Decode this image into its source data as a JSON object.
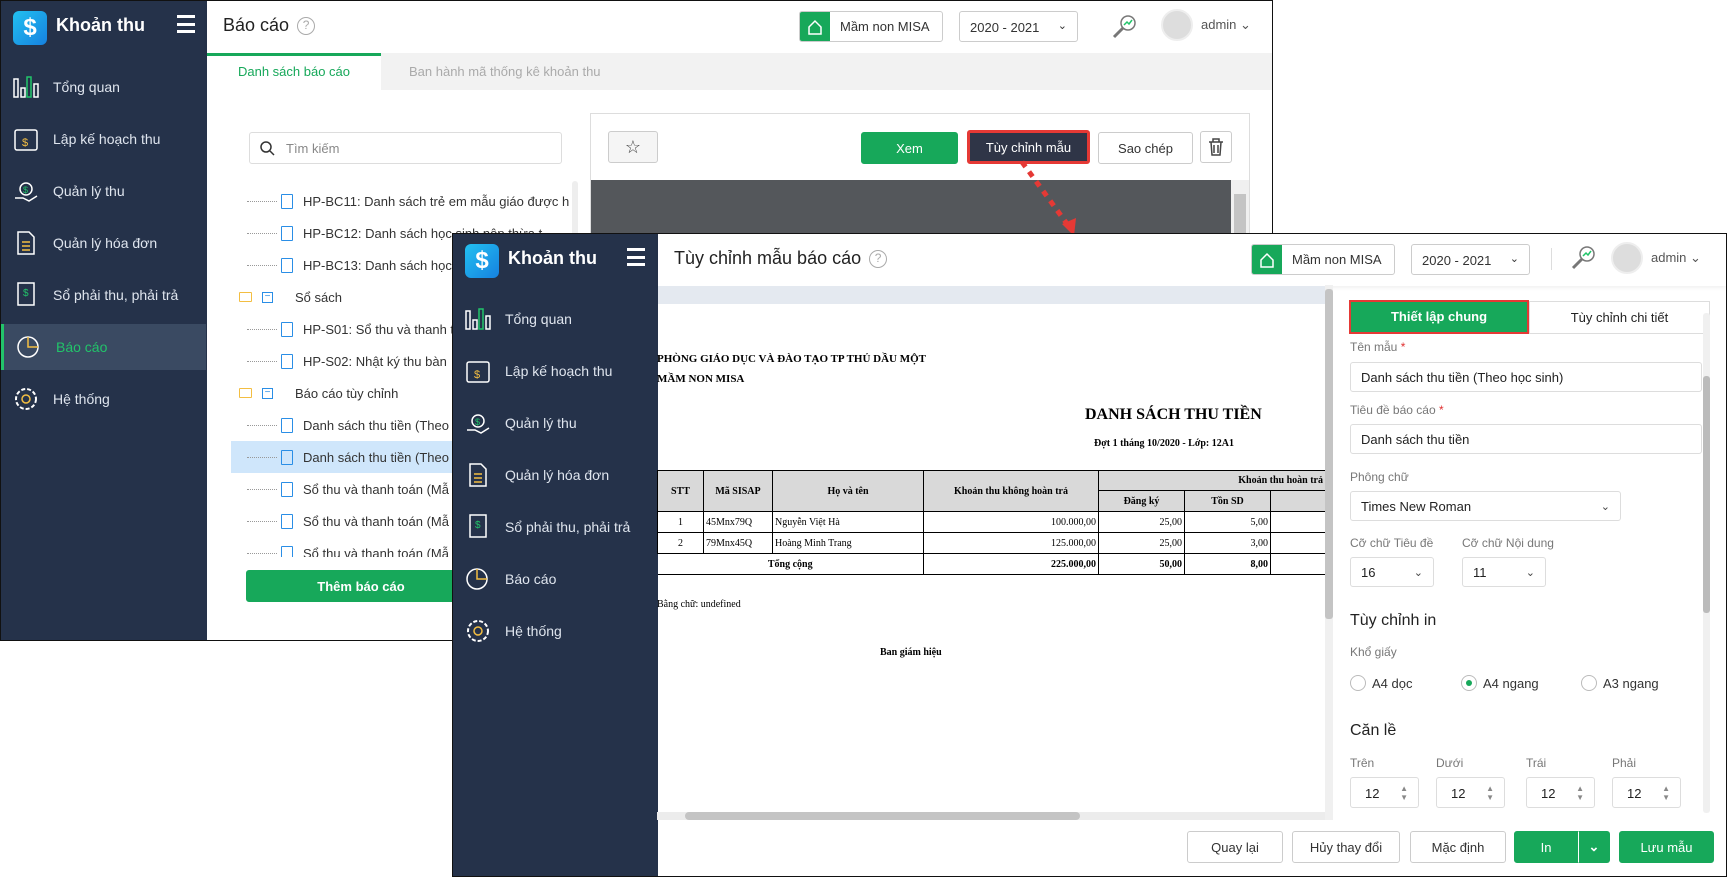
{
  "back": {
    "app_name": "Khoản thu",
    "title": "Báo cáo",
    "school": "Mầm non MISA",
    "year": "2020 - 2021",
    "user": "admin",
    "nav": [
      {
        "label": "Tổng quan",
        "icon": "chart-bars-icon"
      },
      {
        "label": "Lập kế hoạch thu",
        "icon": "calendar-dollar-icon"
      },
      {
        "label": "Quản lý thu",
        "icon": "money-hand-icon"
      },
      {
        "label": "Quản lý hóa đơn",
        "icon": "invoice-icon"
      },
      {
        "label": "Sổ phải thu, phải trả",
        "icon": "ledger-icon"
      },
      {
        "label": "Báo cáo",
        "icon": "pie-chart-icon"
      },
      {
        "label": "Hệ thống",
        "icon": "gear-icon"
      }
    ],
    "tabs": [
      "Danh sách báo cáo",
      "Ban hành mã thống kê khoản thu"
    ],
    "search_placeholder": "Tìm kiếm",
    "tree": [
      {
        "type": "file",
        "label": "HP-BC11: Danh sách trẻ em mẫu giáo được h"
      },
      {
        "type": "file",
        "label": "HP-BC12: Danh sách học sinh nộp thừa t"
      },
      {
        "type": "file",
        "label": "HP-BC13: Danh sách học"
      },
      {
        "type": "folder",
        "label": "Sổ sách"
      },
      {
        "type": "file",
        "label": "HP-S01: Sổ thu và thanh t"
      },
      {
        "type": "file",
        "label": "HP-S02: Nhật ký thu bàn"
      },
      {
        "type": "folder",
        "label": "Báo cáo tùy chỉnh"
      },
      {
        "type": "file",
        "label": "Danh sách thu tiền (Theo"
      },
      {
        "type": "file",
        "label": "Danh sách thu tiền (Theo",
        "selected": true
      },
      {
        "type": "file",
        "label": "Sổ thu và thanh toán (Mẫ"
      },
      {
        "type": "file",
        "label": "Sổ thu và thanh toán (Mẫ"
      },
      {
        "type": "file",
        "label": "Sổ thu và thanh toán (Mẫ"
      }
    ],
    "add_button": "Thêm báo cáo",
    "toolbar": {
      "view": "Xem",
      "customize": "Tùy chỉnh mẫu",
      "copy": "Sao chép"
    }
  },
  "front": {
    "app_name": "Khoản thu",
    "title": "Tùy chỉnh mẫu báo cáo",
    "school": "Mầm non MISA",
    "year": "2020 - 2021",
    "user": "admin",
    "report": {
      "org": "PHÒNG GIÁO DỤC VÀ ĐÀO TẠO TP THỦ DẦU MỘT",
      "school": "MẦM NON MISA",
      "title": "DANH SÁCH THU TIỀN",
      "subtitle": "Đợt 1 tháng 10/2020 - Lớp: 12A1",
      "headers": {
        "stt": "STT",
        "code": "Mã SISAP",
        "name": "Họ và tên",
        "nonrefund": "Khoản thu không hoàn trả",
        "refund": "Khoản thu hoàn trả",
        "registered": "Đăng ký",
        "balance": "Tồn SD"
      },
      "rows": [
        {
          "stt": "1",
          "code": "45Mnx79Q",
          "name": "Nguyễn Việt Hà",
          "nonrefund": "100.000,00",
          "registered": "25,00",
          "balance": "5,00"
        },
        {
          "stt": "2",
          "code": "79Mnx45Q",
          "name": "Hoàng Minh Trang",
          "nonrefund": "125.000,00",
          "registered": "25,00",
          "balance": "3,00"
        }
      ],
      "total": {
        "label": "Tổng cộng",
        "nonrefund": "225.000,00",
        "registered": "50,00",
        "balance": "8,00"
      },
      "in_words": "Bằng chữ: undefined",
      "signature": "Ban giám hiệu"
    },
    "settings": {
      "tabs": [
        "Thiết lập chung",
        "Tùy chỉnh chi tiết"
      ],
      "template_name_label": "Tên mẫu",
      "template_name": "Danh sách thu tiền (Theo học sinh)",
      "report_title_label": "Tiêu đề báo cáo",
      "report_title": "Danh sách thu tiền",
      "font_label": "Phông chữ",
      "font": "Times New Roman",
      "title_size_label": "Cỡ chữ Tiêu đề",
      "title_size": "16",
      "content_size_label": "Cỡ chữ Nội dung",
      "content_size": "11",
      "print_heading": "Tùy chỉnh in",
      "paper_label": "Khổ giấy",
      "paper_options": [
        "A4 dọc",
        "A4 ngang",
        "A3 ngang"
      ],
      "paper_selected": "A4 ngang",
      "margin_heading": "Căn lề",
      "margins": [
        {
          "label": "Trên",
          "value": "12"
        },
        {
          "label": "Dưới",
          "value": "12"
        },
        {
          "label": "Trái",
          "value": "12"
        },
        {
          "label": "Phải",
          "value": "12"
        }
      ]
    },
    "footer": {
      "back": "Quay lại",
      "discard": "Hủy thay đổi",
      "default": "Mặc định",
      "print": "In",
      "save": "Lưu mẫu"
    }
  },
  "colors": {
    "sidebar": "#25324a",
    "accent": "#17a85a",
    "highlight": "#e53935"
  }
}
